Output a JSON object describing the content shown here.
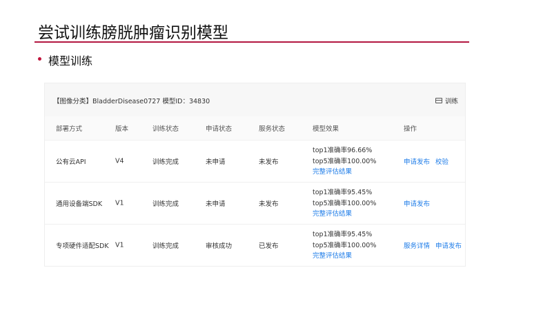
{
  "slide": {
    "title": "尝试训练膀胱肿瘤识别模型",
    "subtitle": "模型训练"
  },
  "panel": {
    "info": "【图像分类】BladderDisease0727 模型ID：34830",
    "train_label": "训练",
    "columns": [
      "部署方式",
      "版本",
      "训练状态",
      "申请状态",
      "服务状态",
      "模型效果",
      "操作"
    ],
    "rows": [
      {
        "deploy": "公有云API",
        "version": "V4",
        "train_status": "训练完成",
        "apply_status": "未申请",
        "service_status": "未发布",
        "top1": "top1准确率96.66%",
        "top5": "top5准确率100.00%",
        "eval_link": "完整评估结果",
        "actions": [
          "申请发布",
          "校验"
        ]
      },
      {
        "deploy": "通用设备端SDK",
        "version": "V1",
        "train_status": "训练完成",
        "apply_status": "未申请",
        "service_status": "未发布",
        "top1": "top1准确率95.45%",
        "top5": "top5准确率100.00%",
        "eval_link": "完整评估结果",
        "actions": [
          "申请发布"
        ]
      },
      {
        "deploy": "专项硬件适配SDK",
        "version": "V1",
        "train_status": "训练完成",
        "apply_status": "审核成功",
        "service_status": "已发布",
        "top1": "top1准确率95.45%",
        "top5": "top5准确率100.00%",
        "eval_link": "完整评估结果",
        "actions": [
          "服务详情",
          "申请发布"
        ]
      }
    ]
  },
  "colors": {
    "accent": "#b3163f",
    "link": "#1e7ce8"
  }
}
